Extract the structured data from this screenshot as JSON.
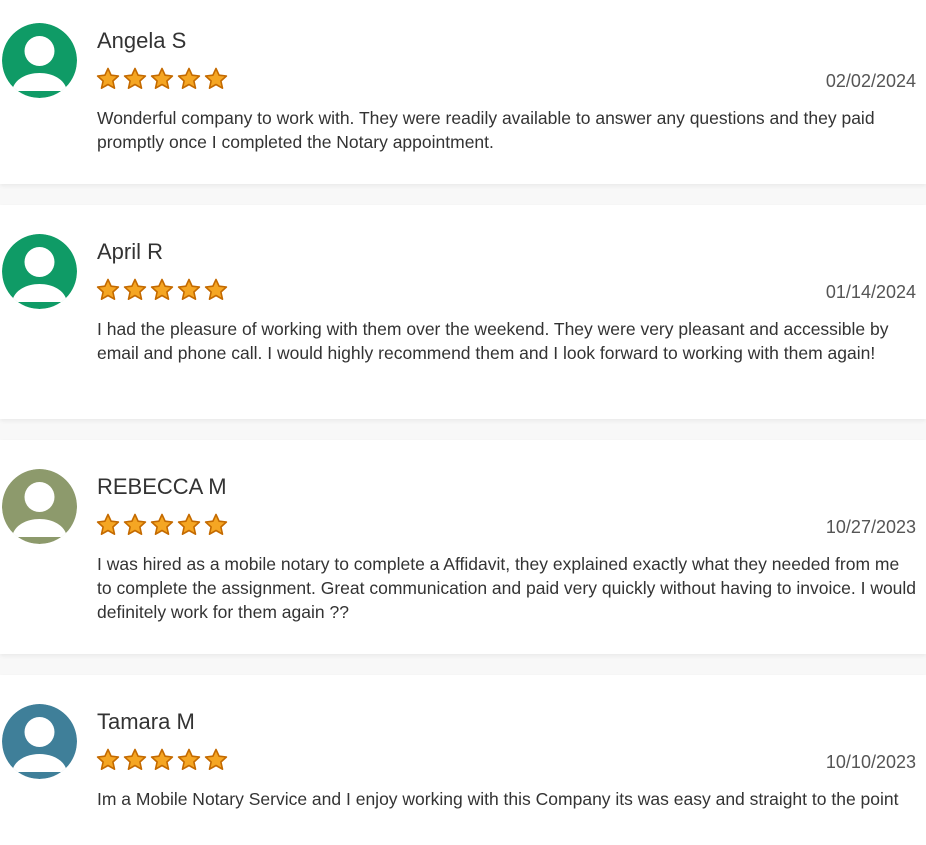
{
  "reviews": [
    {
      "name": "Angela S",
      "rating": 5,
      "date": "02/02/2024",
      "text": "Wonderful company to work with. They were readily available to answer any questions and they paid promptly once I completed the Notary appointment.",
      "avatar_color": "#0f9b66"
    },
    {
      "name": "April R",
      "rating": 5,
      "date": "01/14/2024",
      "text": "I had the pleasure of working with them over the weekend. They were very pleasant and accessible by email and phone call. I would highly recommend them and I look forward to working with them again!",
      "avatar_color": "#0f9b66"
    },
    {
      "name": "REBECCA M",
      "rating": 5,
      "date": "10/27/2023",
      "text": "I was hired as a mobile notary to complete a Affidavit, they explained exactly what they needed from me to complete the assignment. Great communication and paid very quickly without having to invoice. I would definitely work for them again ??",
      "avatar_color": "#8d9a6c"
    },
    {
      "name": "Tamara M",
      "rating": 5,
      "date": "10/10/2023",
      "text": "Im a Mobile Notary Service and I enjoy working with this Company its was easy and straight to the point",
      "avatar_color": "#3f7f99"
    }
  ],
  "colors": {
    "star_fill": "#f5a623",
    "star_stroke": "#c46a00",
    "card_background": "#ffffff",
    "page_background": "#f8f8f8"
  },
  "icons": {
    "avatar": "user-avatar-icon",
    "star": "star-icon"
  }
}
